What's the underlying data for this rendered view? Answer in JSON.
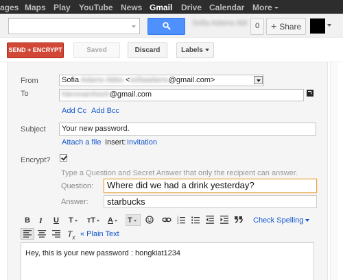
{
  "topbar": {
    "items": [
      "ages",
      "Maps",
      "Play",
      "YouTube",
      "News",
      "Gmail",
      "Drive",
      "Calendar",
      "More"
    ],
    "active": "Gmail"
  },
  "search": {
    "value": "",
    "button_icon": "search-icon"
  },
  "header": {
    "account_name": "Sofia Adams Abbo",
    "notification_count": "0",
    "share_label": "Share"
  },
  "actions": {
    "send_encrypt": "SEND + ENCRYPT",
    "saved": "Saved",
    "discard": "Discard",
    "labels": "Labels"
  },
  "compose": {
    "from_label": "From",
    "from_name": "Sofia",
    "from_hidden": "Adams Abbo",
    "from_email_hidden": "sofiaadams",
    "from_email_suffix": "@gmail.com>",
    "from_lt": "<",
    "to_label": "To",
    "to_hidden": "hieronamhoch",
    "to_suffix": "@gmail.com",
    "add_cc": "Add Cc",
    "add_bcc": "Add Bcc",
    "subject_label": "Subject",
    "subject_value": "Your new password.",
    "attach_file": "Attach a file",
    "insert_label": "Insert:",
    "invitation": "Invitation",
    "encrypt_label": "Encrypt?",
    "encrypt_checked": true,
    "instruction": "Type a Question and Secret Answer that only the recipient can answer.",
    "question_label": "Question:",
    "question_value": "Where did we had a drink yesterday?",
    "answer_label": "Answer:",
    "answer_value": "starbucks"
  },
  "toolbar": {
    "bold": "B",
    "italic": "I",
    "underline": "U",
    "font": "T",
    "size": "тT",
    "text_color": "A",
    "bg_color": "T",
    "check_spelling": "Check Spelling",
    "plain_text": "« Plain Text",
    "clear_format": "T",
    "clear_format_sub": "x"
  },
  "body": {
    "text": "Hey, this is your new password : hongkiat1234"
  },
  "colors": {
    "send_button": "#d14836",
    "search_button": "#4d90fe",
    "link": "#1155cc",
    "topbar": "#2d2d2d",
    "focus_border": "#e8a33d"
  }
}
